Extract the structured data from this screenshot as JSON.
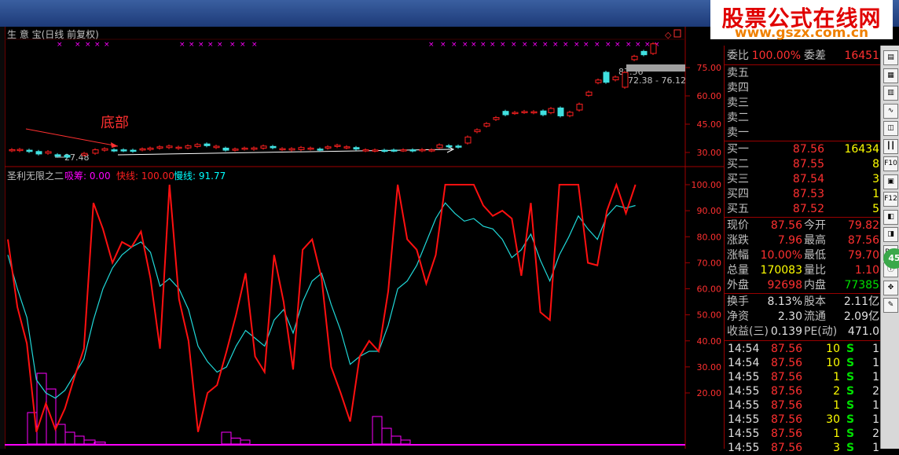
{
  "watermark": {
    "cn": "股票公式在线网",
    "url": "www.gszx.com.cn"
  },
  "main_chart": {
    "title": "生 意 宝(日线 前复权)",
    "annotation": "底部",
    "low_label": "27.48",
    "high_label": "87.56",
    "range_label": "72.38 - 76.12",
    "y_ticks": [
      "75.00",
      "60.00",
      "45.00",
      "30.00"
    ]
  },
  "indicator": {
    "name": "圣利无限之二",
    "series_labels": [
      {
        "text": "吸筹: 0.00",
        "color": "#ff00ff"
      },
      {
        "text": "快线: 100.00",
        "color": "#ff2020"
      },
      {
        "text": "慢线: 91.77",
        "color": "#00ffff"
      }
    ],
    "y_ticks": [
      "100.00",
      "90.00",
      "80.00",
      "70.00",
      "60.00",
      "50.00",
      "40.00",
      "30.00",
      "20.00"
    ]
  },
  "chart_data": {
    "type": "line",
    "x": [
      1,
      2,
      3,
      4,
      5,
      6,
      7,
      8,
      9,
      10,
      11,
      12,
      13,
      14,
      15,
      16,
      17,
      18,
      19,
      20,
      21,
      22,
      23,
      24,
      25,
      26,
      27,
      28,
      29,
      30,
      31,
      32,
      33,
      34,
      35,
      36,
      37,
      38,
      39,
      40,
      41,
      42,
      43,
      44,
      45,
      46,
      47,
      48,
      49,
      50,
      51,
      52,
      53,
      54,
      55,
      56,
      57,
      58,
      59,
      60,
      61,
      62,
      63,
      64,
      65,
      66,
      67,
      68,
      69,
      70
    ],
    "series": [
      {
        "name": "快线",
        "values": [
          79,
          53,
          39,
          5,
          16,
          6,
          14,
          26,
          37,
          93,
          83,
          70,
          78,
          76,
          82,
          64,
          37,
          100,
          56,
          40,
          5,
          20,
          23,
          36,
          50,
          66,
          34,
          28,
          73,
          55,
          29,
          75,
          79,
          64,
          30,
          20,
          9,
          34,
          40,
          36,
          59,
          100,
          79,
          75,
          62,
          73,
          100,
          100,
          100,
          100,
          92,
          88,
          90,
          87,
          65,
          93,
          51,
          48,
          100,
          100,
          100,
          70,
          69,
          90,
          100,
          89,
          100,
          0,
          0,
          0
        ]
      },
      {
        "name": "慢线",
        "values": [
          73,
          60,
          49,
          25,
          20,
          18,
          21,
          27,
          33,
          48,
          60,
          68,
          73,
          76,
          78,
          74,
          61,
          64,
          60,
          52,
          38,
          32,
          28,
          30,
          38,
          44,
          41,
          38,
          48,
          52,
          43,
          55,
          63,
          66,
          54,
          44,
          31,
          34,
          36,
          36,
          46,
          60,
          63,
          69,
          78,
          87,
          93,
          89,
          86,
          87,
          84,
          83,
          79,
          72,
          75,
          81,
          71,
          63,
          73,
          80,
          88,
          83,
          79,
          88,
          92,
          91,
          92,
          0,
          0,
          0
        ]
      }
    ],
    "ylim": [
      0,
      105
    ]
  },
  "quote": {
    "weibi": {
      "label": "委比",
      "value": "100.00%",
      "label2": "委差",
      "value2": "16451"
    },
    "sells": [
      {
        "label": "卖五",
        "price": "",
        "vol": ""
      },
      {
        "label": "卖四",
        "price": "",
        "vol": ""
      },
      {
        "label": "卖三",
        "price": "",
        "vol": ""
      },
      {
        "label": "卖二",
        "price": "",
        "vol": ""
      },
      {
        "label": "卖一",
        "price": "",
        "vol": ""
      }
    ],
    "buys": [
      {
        "label": "买一",
        "price": "87.56",
        "vol": "16434"
      },
      {
        "label": "买二",
        "price": "87.55",
        "vol": "8"
      },
      {
        "label": "买三",
        "price": "87.54",
        "vol": "3"
      },
      {
        "label": "买四",
        "price": "87.53",
        "vol": "1"
      },
      {
        "label": "买五",
        "price": "87.52",
        "vol": "5"
      }
    ],
    "stats": [
      {
        "l1": "现价",
        "v1": "87.56",
        "c1": "red",
        "l2": "今开",
        "v2": "79.82",
        "c2": "red"
      },
      {
        "l1": "涨跌",
        "v1": "7.96",
        "c1": "red",
        "l2": "最高",
        "v2": "87.56",
        "c2": "red"
      },
      {
        "l1": "涨幅",
        "v1": "10.00%",
        "c1": "red",
        "l2": "最低",
        "v2": "79.70",
        "c2": "red"
      },
      {
        "l1": "总量",
        "v1": "170083",
        "c1": "yel",
        "l2": "量比",
        "v2": "1.10",
        "c2": "red"
      },
      {
        "l1": "外盘",
        "v1": "92698",
        "c1": "red",
        "l2": "内盘",
        "v2": "77385",
        "c2": "grn"
      }
    ],
    "stats2": [
      {
        "l1": "换手",
        "v1": "8.13%",
        "l2": "股本",
        "v2": "2.11亿"
      },
      {
        "l1": "净资",
        "v1": "2.30",
        "l2": "流通",
        "v2": "2.09亿"
      },
      {
        "l1": "收益(三)",
        "v1": "0.139",
        "l2": "PE(动)",
        "v2": "471.0"
      }
    ],
    "ticks": [
      {
        "time": "14:54",
        "price": "87.56",
        "vol": "10",
        "side": "S",
        "n": "1"
      },
      {
        "time": "14:54",
        "price": "87.56",
        "vol": "10",
        "side": "S",
        "n": "1"
      },
      {
        "time": "14:55",
        "price": "87.56",
        "vol": "1",
        "side": "S",
        "n": "1"
      },
      {
        "time": "14:55",
        "price": "87.56",
        "vol": "2",
        "side": "S",
        "n": "2"
      },
      {
        "time": "14:55",
        "price": "87.56",
        "vol": "1",
        "side": "S",
        "n": "1"
      },
      {
        "time": "14:55",
        "price": "87.56",
        "vol": "30",
        "side": "S",
        "n": "1"
      },
      {
        "time": "14:55",
        "price": "87.56",
        "vol": "1",
        "side": "S",
        "n": "2"
      },
      {
        "time": "14:55",
        "price": "87.56",
        "vol": "3",
        "side": "S",
        "n": "1"
      }
    ]
  },
  "toolbar": {
    "buttons": [
      {
        "name": "page-button",
        "text": "▤"
      },
      {
        "name": "table-button",
        "text": "▦"
      },
      {
        "name": "grid-button",
        "text": "▥"
      },
      {
        "name": "line-chart-button",
        "text": "∿"
      },
      {
        "name": "minute-chart-button",
        "text": "◫"
      },
      {
        "name": "kline-button",
        "text": "┃┃"
      },
      {
        "name": "f10-button",
        "text": "F10"
      },
      {
        "name": "stats-button",
        "text": "▣"
      },
      {
        "name": "f12-button",
        "text": "F12"
      },
      {
        "name": "indicator-button",
        "text": "◧"
      },
      {
        "name": "sub-chart-button",
        "text": "◨"
      },
      {
        "name": "rsi-button",
        "text": "RSI"
      },
      {
        "name": "info-button",
        "text": "ⓘ"
      },
      {
        "name": "move-button",
        "text": "✥"
      },
      {
        "name": "draw-button",
        "text": "✎"
      }
    ],
    "badge": "45"
  }
}
